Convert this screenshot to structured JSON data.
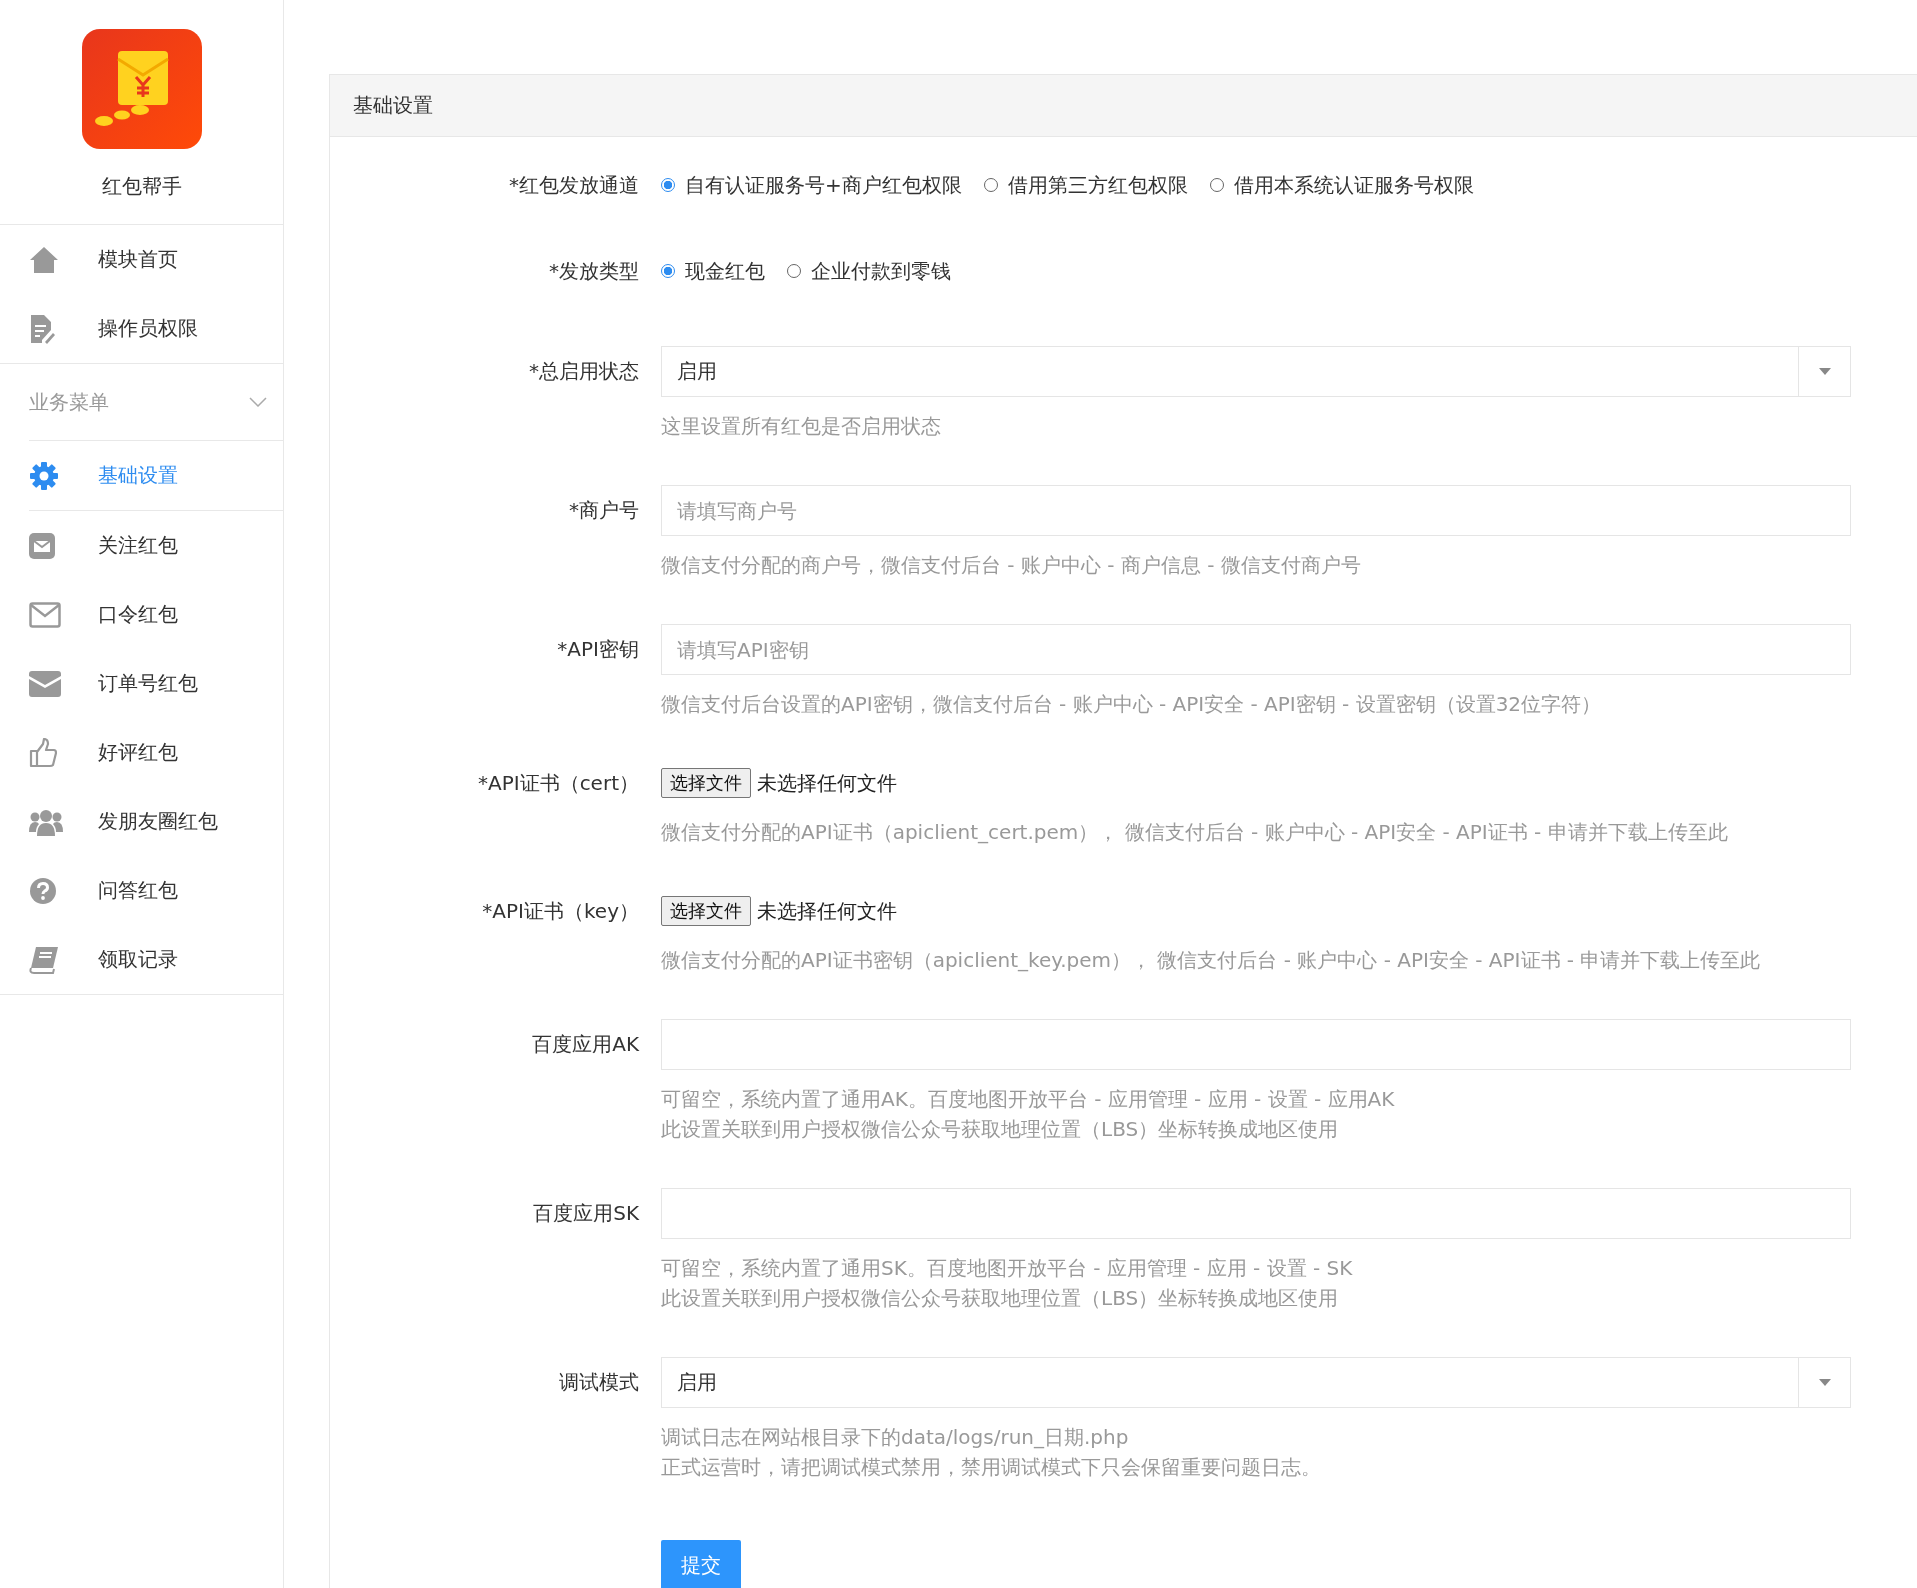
{
  "sidebar": {
    "app_name": "红包帮手",
    "top_items": [
      {
        "label": "模块首页",
        "selected": false
      },
      {
        "label": "操作员权限",
        "selected": false
      }
    ],
    "section": {
      "label": "业务菜单",
      "expanded": true
    },
    "items": [
      {
        "label": "基础设置",
        "selected": true
      },
      {
        "label": "关注红包",
        "selected": false
      },
      {
        "label": "口令红包",
        "selected": false
      },
      {
        "label": "订单号红包",
        "selected": false
      },
      {
        "label": "好评红包",
        "selected": false
      },
      {
        "label": "发朋友圈红包",
        "selected": false
      },
      {
        "label": "问答红包",
        "selected": false
      },
      {
        "label": "领取记录",
        "selected": false
      }
    ]
  },
  "panel": {
    "title": "基础设置",
    "fields": [
      {
        "kind": "radio",
        "label": "*红包发放通道",
        "options": [
          {
            "label": "自有认证服务号+商户红包权限",
            "selected": true
          },
          {
            "label": "借用第三方红包权限",
            "selected": false
          },
          {
            "label": "借用本系统认证服务号权限",
            "selected": false
          }
        ]
      },
      {
        "kind": "radio",
        "label": "*发放类型",
        "options": [
          {
            "label": "现金红包",
            "selected": true
          },
          {
            "label": "企业付款到零钱",
            "selected": false
          }
        ]
      },
      {
        "kind": "select",
        "label": "*总启用状态",
        "value": "启用",
        "help": [
          "这里设置所有红包是否启用状态"
        ]
      },
      {
        "kind": "text",
        "label": "*商户号",
        "placeholder": "请填写商户号",
        "help": [
          "微信支付分配的商户号，微信支付后台 - 账户中心 - 商户信息 - 微信支付商户号"
        ]
      },
      {
        "kind": "text",
        "label": "*API密钥",
        "placeholder": "请填写API密钥",
        "help": [
          "微信支付后台设置的API密钥，微信支付后台 - 账户中心 - API安全 - API密钥 - 设置密钥（设置32位字符）"
        ]
      },
      {
        "kind": "file",
        "label": "*API证书（cert）",
        "button": "选择文件",
        "status": "未选择任何文件",
        "help": [
          "微信支付分配的API证书（apiclient_cert.pem），  微信支付后台 - 账户中心 - API安全 - API证书 - 申请并下载上传至此"
        ]
      },
      {
        "kind": "file",
        "label": "*API证书（key）",
        "button": "选择文件",
        "status": "未选择任何文件",
        "help": [
          "微信支付分配的API证书密钥（apiclient_key.pem），  微信支付后台 - 账户中心 - API安全 - API证书 - 申请并下载上传至此"
        ]
      },
      {
        "kind": "text",
        "label": "百度应用AK",
        "help": [
          "可留空，系统内置了通用AK。百度地图开放平台 - 应用管理 - 应用 - 设置 - 应用AK",
          "此设置关联到用户授权微信公众号获取地理位置（LBS）坐标转换成地区使用"
        ]
      },
      {
        "kind": "text",
        "label": "百度应用SK",
        "help": [
          "可留空，系统内置了通用SK。百度地图开放平台 - 应用管理 - 应用 - 设置 - SK",
          "此设置关联到用户授权微信公众号获取地理位置（LBS）坐标转换成地区使用"
        ]
      },
      {
        "kind": "select",
        "label": "调试模式",
        "value": "启用",
        "help": [
          "调试日志在网站根目录下的data/logs/run_日期.php",
          "正式运营时，请把调试模式禁用，禁用调试模式下只会保留重要问题日志。"
        ]
      }
    ],
    "submit": "提交"
  }
}
